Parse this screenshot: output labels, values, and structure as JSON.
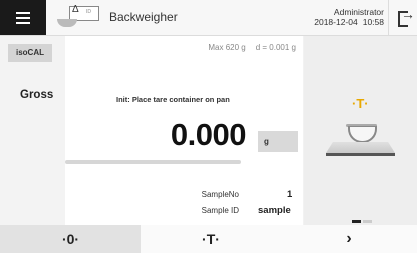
{
  "header": {
    "app_title": "Backweigher",
    "icon_delta": "Δ",
    "icon_sub": "ID",
    "user": "Administrator",
    "date": "2018-12-04",
    "time": "10:58"
  },
  "left_tabs": {
    "iscal_label": "isoCAL"
  },
  "weighing": {
    "max_capacity": "Max 620 g",
    "readability": "d = 0.001 g",
    "mode_label": "Gross",
    "instruction": "Init: Place tare container on pan",
    "value": "0.000",
    "unit": "g",
    "sample_no_label": "SampleNo",
    "sample_no_value": "1",
    "sample_id_label": "Sample ID",
    "sample_id_value": "sample"
  },
  "tare_panel": {
    "tare_symbol": "·T·"
  },
  "footer": {
    "zero_label": "·0·",
    "tare_label": "·T·",
    "next_label": "›"
  }
}
